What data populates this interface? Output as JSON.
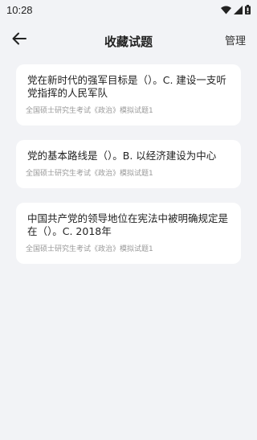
{
  "status_bar": {
    "time": "10:28",
    "icons": [
      "wifi-icon",
      "signal-icon",
      "battery-icon"
    ]
  },
  "header": {
    "back_icon": "arrow-left-icon",
    "title": "收藏试题",
    "manage_label": "管理"
  },
  "questions": [
    {
      "text": "党在新时代的强军目标是（）。C. 建设一支听党指挥的人民军队",
      "source": "全国硕士研究生考试《政治》模拟试题1"
    },
    {
      "text": "党的基本路线是（）。B. 以经济建设为中心",
      "source": "全国硕士研究生考试《政治》模拟试题1"
    },
    {
      "text": "中国共产党的领导地位在宪法中被明确规定是在（）。C. 2018年",
      "source": "全国硕士研究生考试《政治》模拟试题1"
    }
  ],
  "colors": {
    "background": "#f2f3f6",
    "card": "#ffffff",
    "source_text": "#9a9a9a"
  }
}
